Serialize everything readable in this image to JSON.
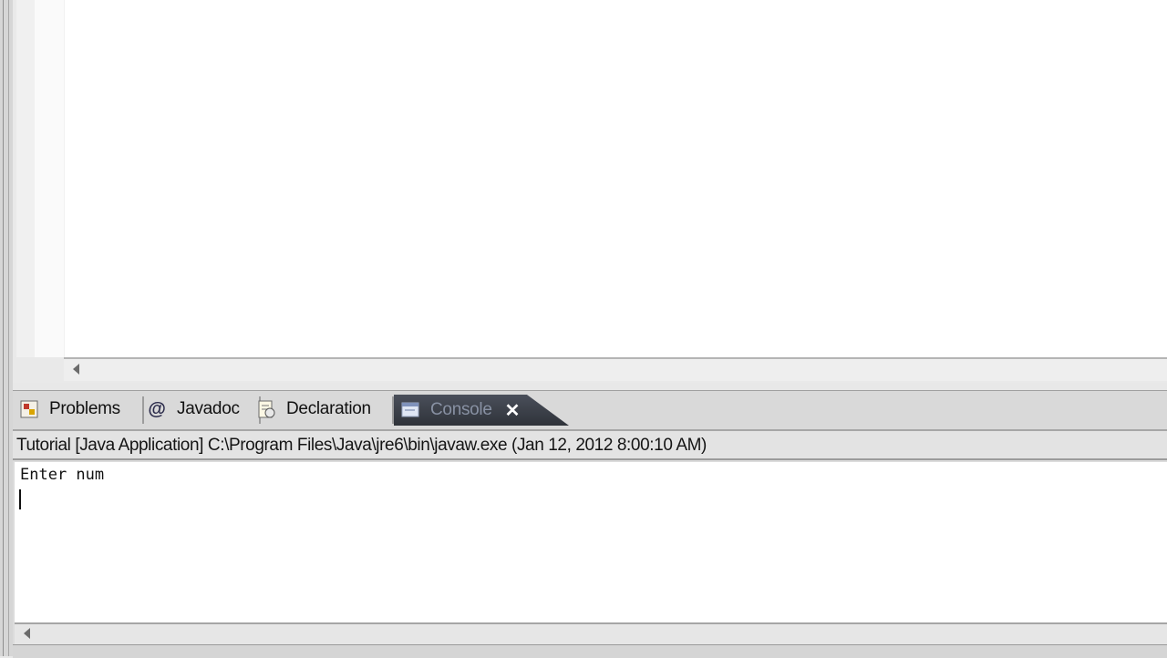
{
  "view_tabs": [
    {
      "label": "Problems",
      "icon": "problems-icon"
    },
    {
      "label": "Javadoc",
      "icon": "at-icon"
    },
    {
      "label": "Declaration",
      "icon": "declaration-icon"
    },
    {
      "label": "Console",
      "icon": "console-icon",
      "active": true
    }
  ],
  "console": {
    "launch_title": "Tutorial [Java Application] C:\\Program Files\\Java\\jre6\\bin\\javaw.exe (Jan 12, 2012 8:00:10 AM)",
    "output_lines": [
      "Enter num"
    ],
    "close_glyph": "✕"
  },
  "colors": {
    "active_tab_bg": "#3a3f48",
    "console_bg": "#ffffff"
  }
}
